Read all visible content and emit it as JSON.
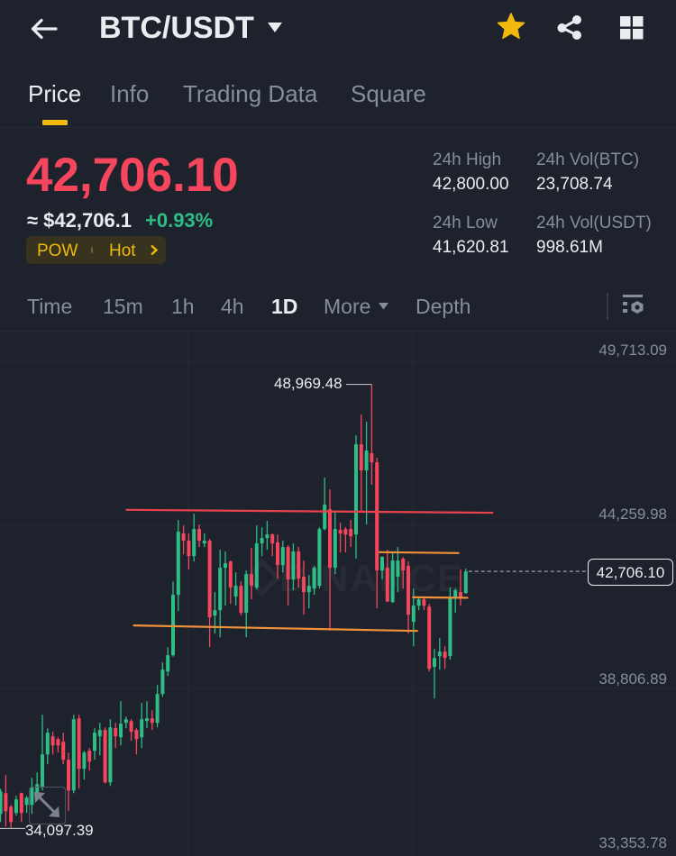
{
  "header": {
    "title": "BTC/USDT",
    "icons": {
      "back": "arrow-left-icon",
      "symbol_dropdown": "caret-down-icon",
      "favorite": "star-icon",
      "share": "share-icon",
      "more_apps": "grid-icon"
    },
    "favorite_active": true
  },
  "tabs": [
    {
      "label": "Price",
      "active": true
    },
    {
      "label": "Info",
      "active": false
    },
    {
      "label": "Trading Data",
      "active": false
    },
    {
      "label": "Square",
      "active": false
    }
  ],
  "price": {
    "last": "42,706.10",
    "usd_equivalent": "≈ $42,706.1",
    "change_percent": "+0.93%",
    "tags": [
      "POW",
      "Hot"
    ]
  },
  "stats": [
    {
      "label": "24h High",
      "value": "42,800.00"
    },
    {
      "label": "24h Vol(BTC)",
      "value": "23,708.74"
    },
    {
      "label": "24h Low",
      "value": "41,620.81"
    },
    {
      "label": "24h Vol(USDT)",
      "value": "998.61M"
    }
  ],
  "intervals": {
    "items": [
      "Time",
      "15m",
      "1h",
      "4h",
      "1D",
      "More",
      "Depth"
    ],
    "active": "1D",
    "settings_icon": "chart-settings-icon"
  },
  "colors": {
    "up": "#2ebd85",
    "down": "#f6465d",
    "accent": "#f0b90b"
  },
  "watermark": "BINANCE",
  "chart_data": {
    "type": "candlestick",
    "symbol": "BTC/USDT",
    "interval": "1D",
    "grid": true,
    "y_axis": {
      "position": "right",
      "ticks": [
        49713.09,
        44259.98,
        38806.89,
        33353.78
      ],
      "tick_labels": [
        "49,713.09",
        "44,259.98",
        "38,806.89",
        "33,353.78"
      ]
    },
    "last_price": 42706.1,
    "last_price_label": "42,706.10",
    "markers": {
      "max": {
        "index": 71,
        "value": 48969.48,
        "label": "48,969.48"
      },
      "min": {
        "index": 2,
        "value": 34097.39,
        "label": "34,097.39"
      }
    },
    "ohlc_fields": [
      "open",
      "high",
      "low",
      "close"
    ],
    "candles_ohlc": [
      [
        34583,
        35428,
        34311,
        35338
      ],
      [
        35277,
        35881,
        34160,
        34673
      ],
      [
        34824,
        34885,
        34097.39,
        34311
      ],
      [
        34613,
        35187,
        34522,
        35066
      ],
      [
        35277,
        35300,
        34311,
        34613
      ],
      [
        34885,
        35187,
        34613,
        35126
      ],
      [
        34885,
        35791,
        34583,
        35489
      ],
      [
        35277,
        35972,
        35066,
        35579
      ],
      [
        35489,
        37905,
        35368,
        36576
      ],
      [
        36576,
        37452,
        36244,
        37301
      ],
      [
        37180,
        37331,
        36576,
        36878
      ],
      [
        37089,
        37150,
        36636,
        36878
      ],
      [
        36999,
        37301,
        36244,
        36395
      ],
      [
        36395,
        36636,
        34673,
        35368
      ],
      [
        35368,
        37905,
        35277,
        37754
      ],
      [
        37784,
        37905,
        35428,
        36093
      ],
      [
        36093,
        36697,
        35730,
        36636
      ],
      [
        36697,
        36787,
        36032,
        36334
      ],
      [
        36697,
        37452,
        36395,
        37301
      ],
      [
        37180,
        37633,
        36546,
        37391
      ],
      [
        37391,
        37482,
        35600,
        35640
      ],
      [
        35640,
        37754,
        35519,
        37482
      ],
      [
        37452,
        37633,
        36787,
        37180
      ],
      [
        37150,
        38358,
        36878,
        37603
      ],
      [
        37633,
        37844,
        37452,
        37754
      ],
      [
        37693,
        37754,
        37029,
        37331
      ],
      [
        37391,
        37452,
        36576,
        37089
      ],
      [
        37150,
        38297,
        36787,
        37754
      ],
      [
        37693,
        38358,
        37452,
        37784
      ],
      [
        37784,
        38056,
        37391,
        37633
      ],
      [
        37633,
        38901,
        37482,
        38599
      ],
      [
        38599,
        39656,
        38509,
        39415
      ],
      [
        39354,
        40170,
        39203,
        39898
      ],
      [
        39898,
        42374,
        39850,
        41921
      ],
      [
        41921,
        44428,
        41378,
        44035
      ],
      [
        43975,
        44247,
        43280,
        43733
      ],
      [
        43733,
        43975,
        42767,
        43220
      ],
      [
        43220,
        44639,
        43039,
        44126
      ],
      [
        44126,
        44277,
        43522,
        43733
      ],
      [
        43643,
        43975,
        43522,
        43733
      ],
      [
        43733,
        43794,
        40170,
        41166
      ],
      [
        41227,
        42012,
        40623,
        41408
      ],
      [
        41408,
        43431,
        40502,
        42827
      ],
      [
        42827,
        43371,
        41559,
        42978
      ],
      [
        43039,
        43069,
        41619,
        42163
      ],
      [
        41861,
        42676,
        41559,
        42223
      ],
      [
        42223,
        42374,
        41227,
        41317
      ],
      [
        41317,
        42737,
        40502,
        42616
      ],
      [
        42616,
        43492,
        41770,
        42223
      ],
      [
        42163,
        44247,
        42100,
        43643
      ],
      [
        43643,
        44186,
        43220,
        43824
      ],
      [
        43824,
        44398,
        43431,
        43945
      ],
      [
        43945,
        43975,
        43220,
        43643
      ],
      [
        43673,
        43945,
        42465,
        42918
      ],
      [
        42918,
        43733,
        42676,
        43522
      ],
      [
        43522,
        43582,
        41559,
        42435
      ],
      [
        42435,
        43643,
        42072,
        43371
      ],
      [
        43371,
        43522,
        42163,
        42465
      ],
      [
        42525,
        43069,
        41257,
        42012
      ],
      [
        42012,
        42586,
        41468,
        42223
      ],
      [
        42133,
        42888,
        41921,
        42827
      ],
      [
        42223,
        44186,
        42133,
        44126
      ],
      [
        44126,
        45847,
        44080,
        44941
      ],
      [
        44790,
        45455,
        40713,
        42827
      ],
      [
        42827,
        44700,
        42616,
        44126
      ],
      [
        44096,
        44337,
        43341,
        43975
      ],
      [
        44126,
        44186,
        43341,
        43945
      ],
      [
        44126,
        44428,
        43522,
        43884
      ],
      [
        43945,
        47267,
        43129,
        46965
      ],
      [
        46965,
        47961,
        44730,
        46089
      ],
      [
        46089,
        47720,
        44277,
        46753
      ],
      [
        46663,
        48969.48,
        45606,
        46361
      ],
      [
        46361,
        46512,
        41468,
        42737
      ],
      [
        42737,
        43220,
        42435,
        43190
      ],
      [
        42827,
        43431,
        41680,
        41700
      ],
      [
        41680,
        43341,
        41650,
        43069
      ],
      [
        42525,
        43522,
        42012,
        43069
      ],
      [
        43129,
        43190,
        42133,
        42737
      ],
      [
        42888,
        43039,
        40623,
        41257
      ],
      [
        41015,
        42133,
        40200,
        41559
      ],
      [
        41559,
        41861,
        41408,
        41770
      ],
      [
        41770,
        41831,
        41408,
        41559
      ],
      [
        41529,
        41619,
        39354,
        39445
      ],
      [
        39505,
        40109,
        38448,
        39807
      ],
      [
        39868,
        40472,
        39415,
        40019
      ],
      [
        40019,
        40200,
        39445,
        39807
      ],
      [
        39868,
        42163,
        39747,
        41861
      ],
      [
        41831,
        42133,
        41317,
        42072
      ],
      [
        42012,
        42767,
        41559,
        41831
      ],
      [
        41982,
        42800,
        41950,
        42706.1
      ]
    ],
    "annotations": [
      {
        "name": "resistance",
        "type": "trendline",
        "color": "#e8424f",
        "from": [
          24.1,
          44769
        ],
        "to": [
          94.1,
          44670
        ]
      },
      {
        "name": "support",
        "type": "trendline",
        "color": "#f0913a",
        "from": [
          25.5,
          40895
        ],
        "to": [
          79.7,
          40713
        ]
      },
      {
        "name": "upper-range",
        "type": "trendline",
        "color": "#f0913a",
        "from": [
          72.5,
          43350
        ],
        "to": [
          87.6,
          43320
        ]
      },
      {
        "name": "lower-range",
        "type": "trendline",
        "color": "#f0913a",
        "from": [
          78.9,
          41840
        ],
        "to": [
          89.3,
          41822
        ]
      }
    ]
  }
}
